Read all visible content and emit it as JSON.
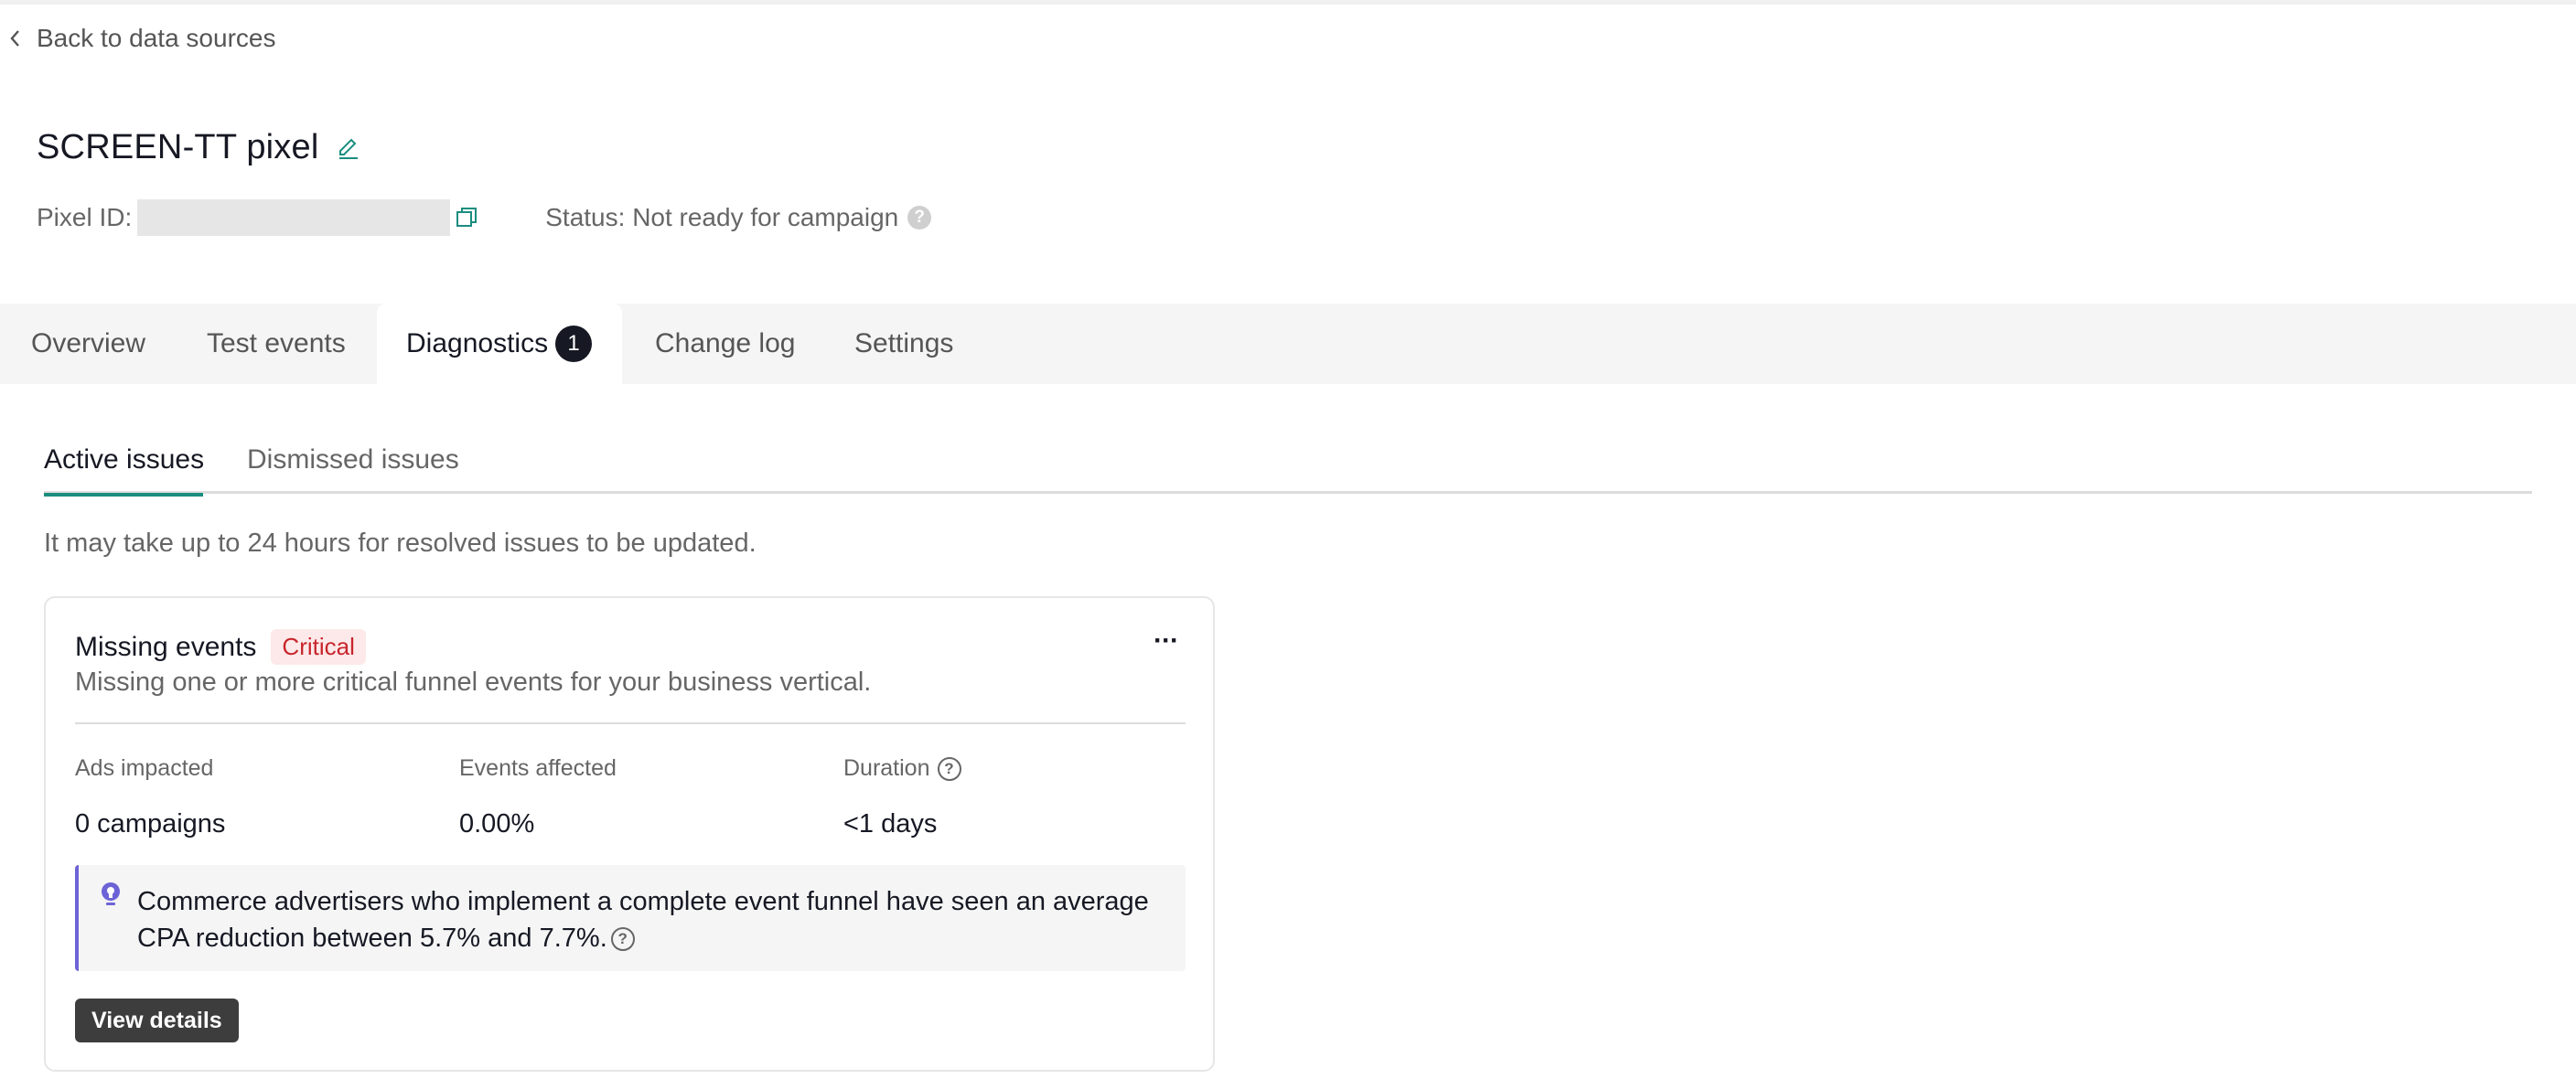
{
  "nav": {
    "back_label": "Back to data sources"
  },
  "header": {
    "title": "SCREEN-TT pixel",
    "pixel_id_label": "Pixel ID:",
    "status_text": "Status: Not ready for campaign"
  },
  "tabs": [
    {
      "label": "Overview"
    },
    {
      "label": "Test events"
    },
    {
      "label": "Diagnostics",
      "badge": "1"
    },
    {
      "label": "Change log"
    },
    {
      "label": "Settings"
    }
  ],
  "subtabs": [
    {
      "label": "Active issues"
    },
    {
      "label": "Dismissed issues"
    }
  ],
  "note": "It may take up to 24 hours for resolved issues to be updated.",
  "issue": {
    "title": "Missing events",
    "severity": "Critical",
    "description": "Missing one or more critical funnel events for your business vertical.",
    "more_label": "···",
    "metrics": [
      {
        "label": "Ads impacted",
        "value": "0 campaigns"
      },
      {
        "label": "Events affected",
        "value": "0.00%"
      },
      {
        "label": "Duration",
        "value": "<1 days"
      }
    ],
    "tip": "Commerce advertisers who implement a complete event funnel have seen an average CPA reduction between 5.7% and 7.7%.",
    "action_label": "View details"
  },
  "icons": {
    "back": "chevron-left-icon",
    "edit": "pencil-icon",
    "copy": "copy-icon",
    "help": "question-icon",
    "tip": "lightbulb-icon"
  },
  "colors": {
    "accent": "#1a8d7f",
    "critical_text": "#c8252c",
    "critical_bg": "#fde9e9",
    "tip_border": "#6c63d6",
    "badge_bg": "#161823"
  }
}
